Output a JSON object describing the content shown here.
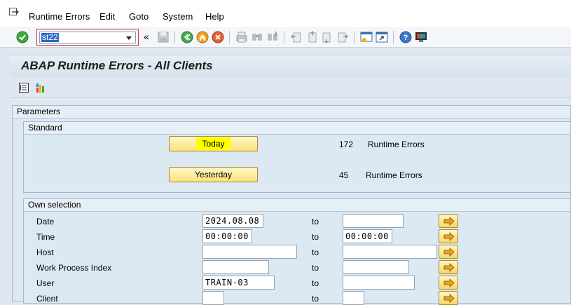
{
  "menu": {
    "items": [
      "Runtime Errors",
      "Edit",
      "Goto",
      "System",
      "Help"
    ],
    "menu_icon": "exit-menu-icon"
  },
  "toolbar": {
    "command_value": "st22",
    "icons": [
      "enter-icon",
      "save-icon",
      "back-icon",
      "exit-icon",
      "cancel-icon",
      "print-icon",
      "find-icon",
      "find-next-icon",
      "first-page-icon",
      "previous-page-icon",
      "next-page-icon",
      "last-page-icon",
      "create-session-icon",
      "shortcut-icon",
      "help-icon",
      "customize-layout-icon"
    ]
  },
  "title": "ABAP Runtime Errors - All Clients",
  "parameters": {
    "header": "Parameters",
    "standard": {
      "header": "Standard",
      "today_label": "Today",
      "today_count": "172",
      "today_unit": "Runtime Errors",
      "yesterday_label": "Yesterday",
      "yesterday_count": "45",
      "yesterday_unit": "Runtime Errors"
    },
    "own_selection": {
      "header": "Own selection",
      "to_label": "to",
      "rows": [
        {
          "label": "Date",
          "from": "2024.08.08",
          "to": ""
        },
        {
          "label": "Time",
          "from": "00:00:00",
          "to": "00:00:00"
        },
        {
          "label": "Host",
          "from": "",
          "to": ""
        },
        {
          "label": "Work Process Index",
          "from": "",
          "to": ""
        },
        {
          "label": "User",
          "from": "TRAIN-03",
          "to": ""
        },
        {
          "label": "Client",
          "from": "",
          "to": ""
        }
      ]
    }
  },
  "colors": {
    "background": "#dfe8f1",
    "button_yellow": "#fbe27a",
    "highlight": "#ffff00",
    "command_selection": "#3168c6"
  }
}
